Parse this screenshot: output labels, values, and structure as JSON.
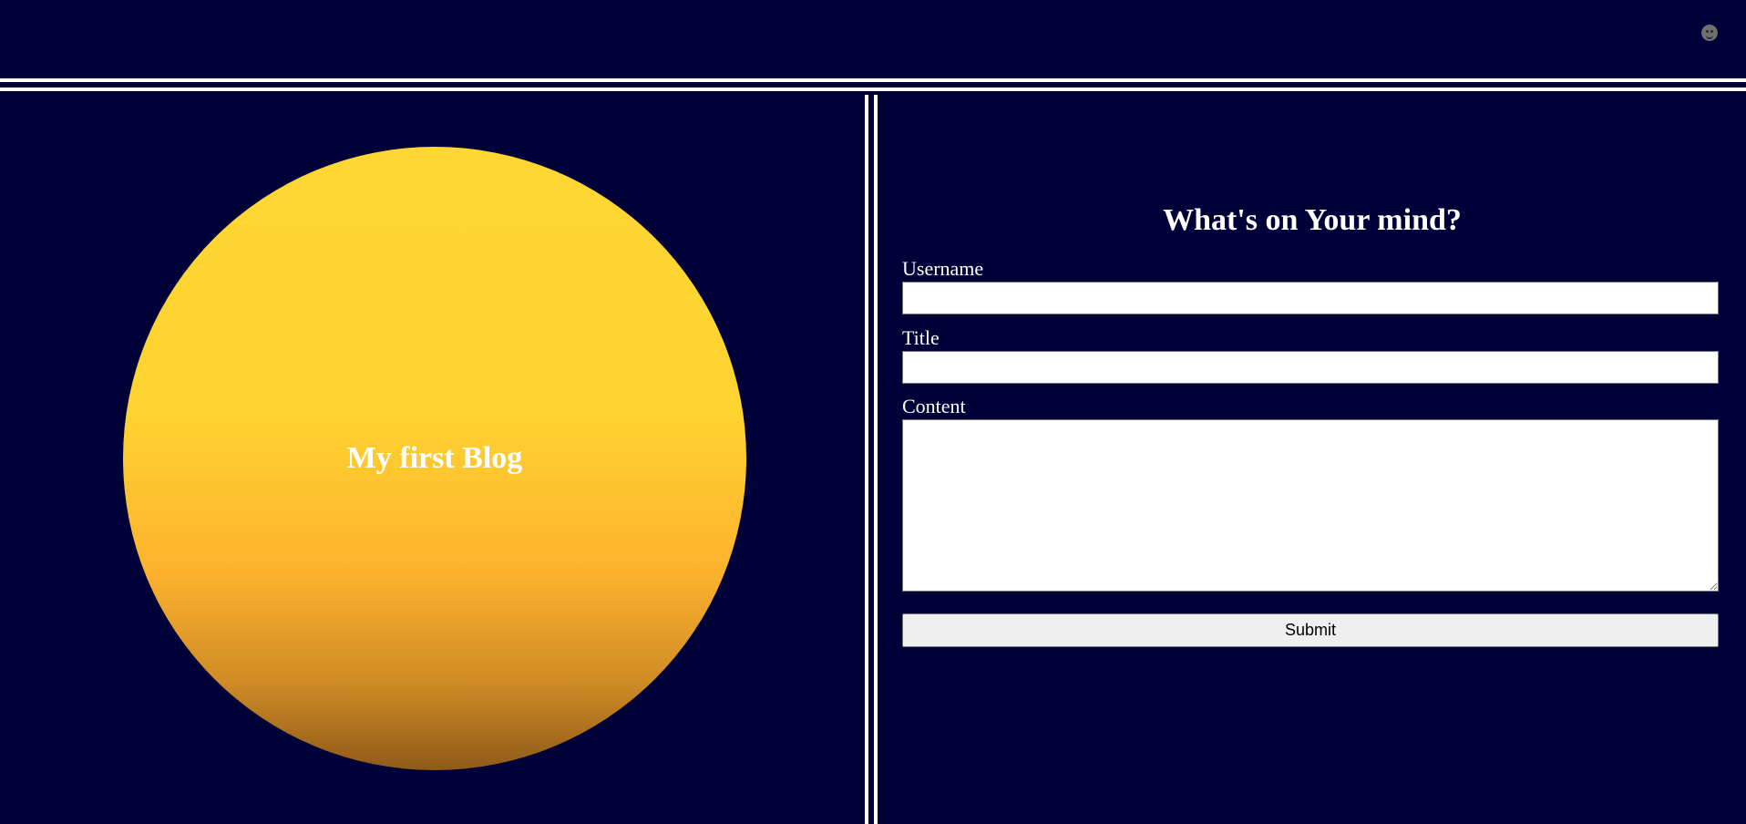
{
  "header": {
    "avatar_icon": "smiley-face-icon"
  },
  "hero": {
    "title": "My first Blog"
  },
  "form": {
    "heading": "What's on Your mind?",
    "username_label": "Username",
    "username_value": "",
    "title_label": "Title",
    "title_value": "",
    "content_label": "Content",
    "content_value": "",
    "submit_label": "Submit"
  },
  "colors": {
    "background": "#000038",
    "divider": "#ffffff",
    "sun_top": "#ffd632",
    "sun_bottom": "#8f5a1a"
  }
}
